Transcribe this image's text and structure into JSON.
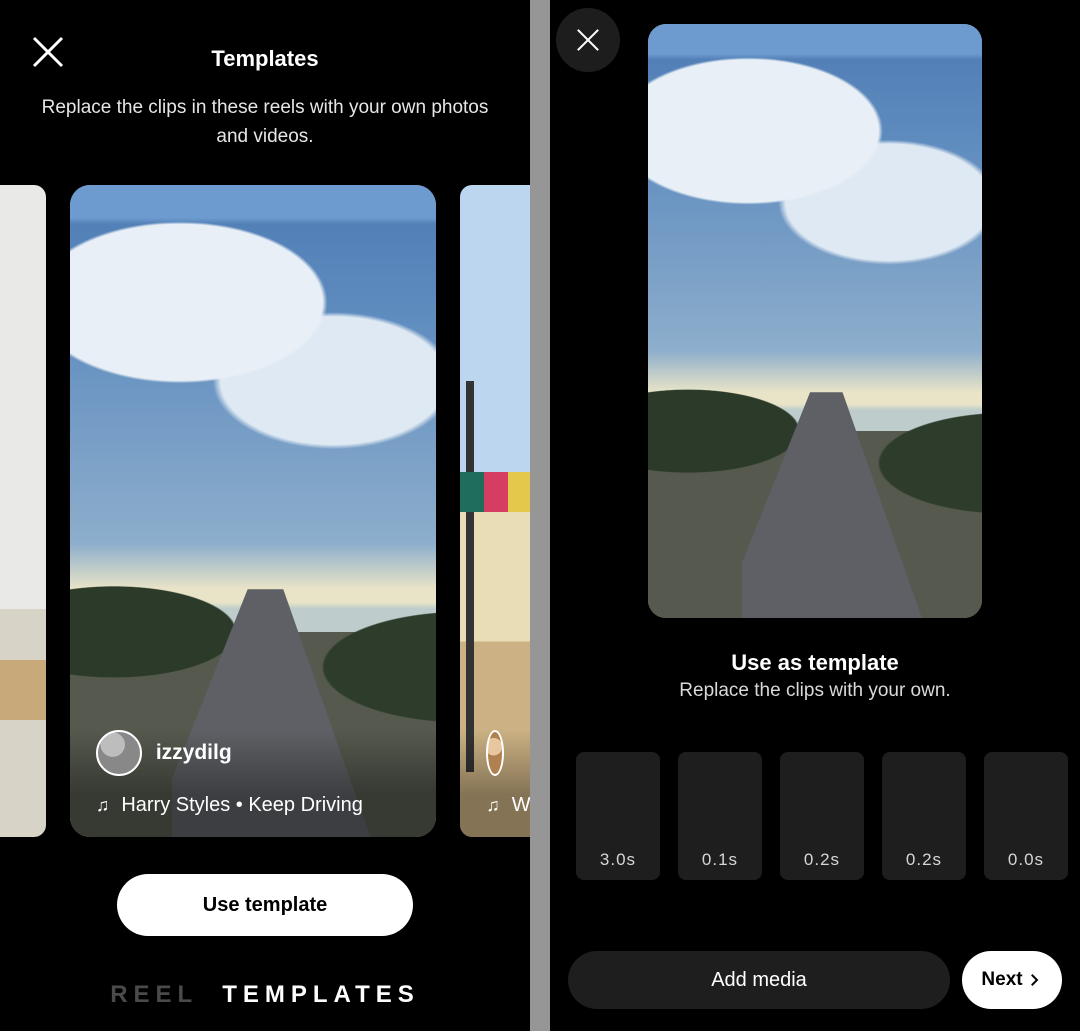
{
  "left": {
    "title": "Templates",
    "subtitle": "Replace the clips in these reels with your own photos and videos.",
    "center_card": {
      "username": "izzydilg",
      "music": "Harry Styles • Keep Driving"
    },
    "right_peek": {
      "music_prefix": "W"
    },
    "use_template_label": "Use template",
    "tabs": {
      "reel": "REEL",
      "templates": "TEMPLATES"
    }
  },
  "right": {
    "title": "Use as template",
    "subtitle": "Replace the clips with your own.",
    "clip_slots": [
      "3.0s",
      "0.1s",
      "0.2s",
      "0.2s",
      "0.0s"
    ],
    "add_media_label": "Add media",
    "next_label": "Next"
  }
}
